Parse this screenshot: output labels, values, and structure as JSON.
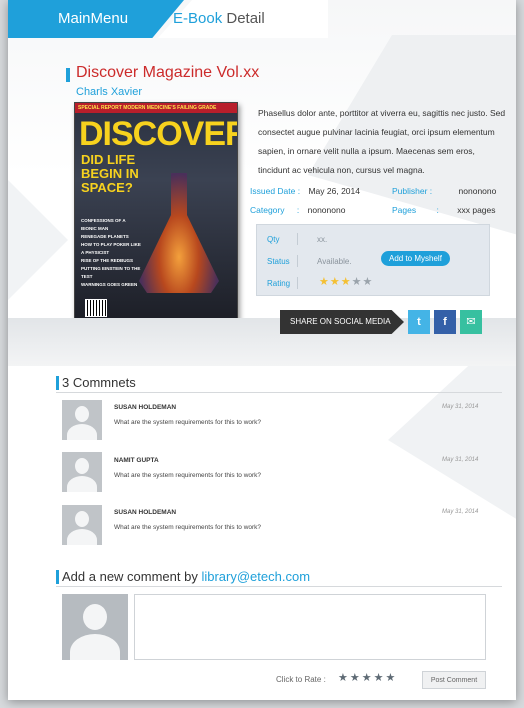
{
  "nav": {
    "main_menu_label": "MainMenu",
    "detail_label_1": "E-Book",
    "detail_label_2": " Detail"
  },
  "book": {
    "title": "Discover Magazine Vol.xx",
    "author": "Charls Xavier",
    "description": "Phasellus dolor ante, porttitor at viverra eu, sagittis nec justo. Sed consectet augue pulvinar lacinia feugiat, orci ipsum elementum sapien, in ornare velit nulla a ipsum. Maecenas sem eros, tincidunt ac vehicula non, cursus vel magna.",
    "cover": {
      "strip": "SPECIAL REPORT MODERN MEDICINE'S FAILING GRADE",
      "masthead": "DISCOVER",
      "headline": "DID LIFE BEGIN IN SPACE?",
      "lines": [
        "CONFESSIONS OF A BIONIC MAN",
        "RENEGADE PLANETS",
        "HOW TO PLAY POKER LIKE A PHYSICIST",
        "RISE OF THE REDBUGS",
        "PUTTING EINSTEIN TO THE TEST",
        "WARNINGS GOES GREEN"
      ]
    }
  },
  "meta": {
    "issued_label": "Issued Date :",
    "issued_value": "May 26, 2014",
    "publisher_label": "Publisher :",
    "publisher_value": "nononono",
    "category_label": "Category",
    "category_sep": ":",
    "category_value": "nononono",
    "pages_label": "Pages",
    "pages_sep": ":",
    "pages_value": "xxx pages"
  },
  "stats": {
    "qty_label": "Qty",
    "qty_value": "xx.",
    "status_label": "Status",
    "status_value": "Available.",
    "add_button": "Add to Myshelf",
    "rating_label": "Rating",
    "rating_value": 3,
    "rating_max": 5
  },
  "share": {
    "label": "SHARE ON SOCIAL MEDIA",
    "twitter_glyph": "t",
    "facebook_glyph": "f",
    "mail_glyph": "✉"
  },
  "comments": {
    "title": "3 Commnets",
    "items": [
      {
        "name": "SUSAN HOLDEMAN",
        "text": "What are the system requirements for this to work?",
        "date": "May 31, 2014"
      },
      {
        "name": "NAMIT GUPTA",
        "text": "What are the system requirements for this to work?",
        "date": "May 31, 2014"
      },
      {
        "name": "SUSAN HOLDEMAN",
        "text": "What are the system requirements for this to work?",
        "date": "May 31, 2014"
      }
    ]
  },
  "new_comment": {
    "title_prefix": "Add a new comment by ",
    "user": "library@etech.com",
    "input_value": "",
    "rate_label": "Click to Rate :",
    "post_button": "Post Comment"
  },
  "colors": {
    "accent": "#1fa0da",
    "title_red": "#cc2b2b",
    "star_on": "#f4c033"
  }
}
